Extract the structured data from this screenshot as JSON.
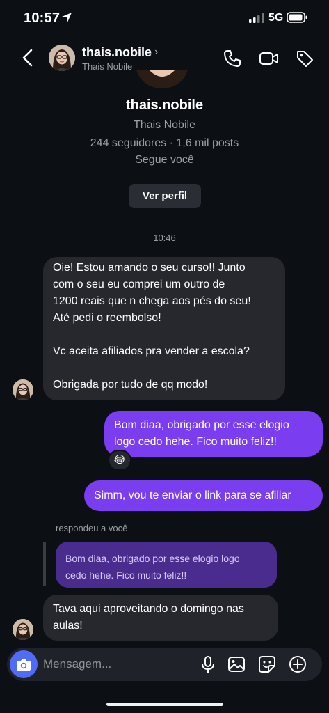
{
  "status_bar": {
    "time": "10:57",
    "network": "5G"
  },
  "header": {
    "username": "thais.nobile",
    "chevron": "›",
    "subtitle": "Thais Nobile",
    "icons": [
      "back-icon",
      "phone-icon",
      "video-icon",
      "tag-icon"
    ]
  },
  "profile": {
    "username": "thais.nobile",
    "full_name": "Thais Nobile",
    "stats": "244 seguidores · 1,6 mil posts",
    "follows_status": "Segue você",
    "view_profile_label": "Ver perfil"
  },
  "conversation": {
    "timestamp": "10:46",
    "incoming_1": {
      "lines": [
        "Oie! Estou amando o seu curso!! Junto",
        "com o seu eu comprei um outro de",
        "1200 reais que n chega aos pés do seu!",
        "Até pedi o reembolso!",
        "",
        "Vc aceita afiliados pra vender a escola?",
        "",
        "Obrigada por tudo de qq modo!"
      ]
    },
    "outgoing_1": {
      "lines": [
        "Bom diaa, obrigado por esse elogio",
        "logo cedo hehe. Fico muito feliz!!"
      ],
      "reaction": "😂"
    },
    "outgoing_2": {
      "text": "Simm, vou te enviar o link para se afiliar"
    },
    "reply_context": {
      "label": "respondeu a você",
      "quote_lines": [
        "Bom diaa, obrigado por esse elogio logo",
        "cedo hehe. Fico muito feliz!!"
      ]
    },
    "incoming_2": {
      "lines": [
        "Tava aqui aproveitando o domingo nas",
        "aulas!"
      ]
    }
  },
  "composer": {
    "placeholder": "Mensagem...",
    "icons": [
      "camera-icon",
      "microphone-icon",
      "gallery-icon",
      "sticker-icon",
      "add-icon"
    ]
  },
  "colors": {
    "background": "#0c0f14",
    "incoming_bubble": "#26282e",
    "outgoing_bubble": "#7a3df0",
    "reply_quote": "#4a2c8f",
    "camera_button": "#4f6cf7"
  }
}
